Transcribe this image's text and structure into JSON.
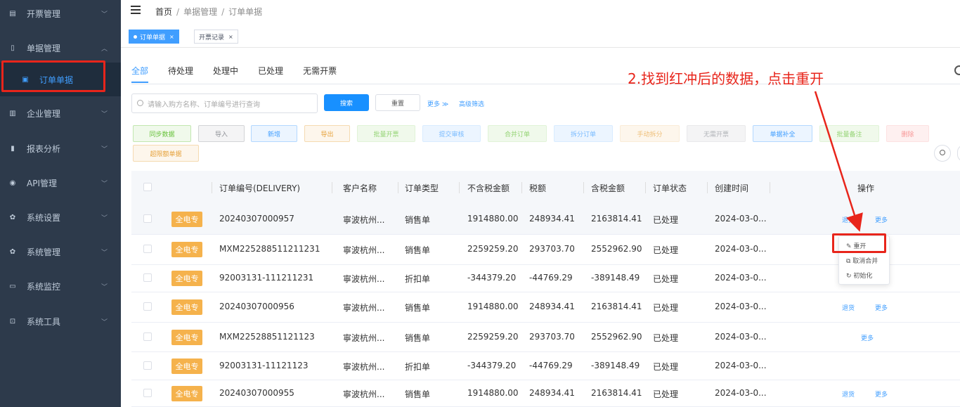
{
  "sidebar": {
    "items": [
      {
        "label": "开票管理",
        "icon": "invoice-icon"
      },
      {
        "label": "单据管理",
        "icon": "document-icon"
      },
      {
        "label": "订单单据",
        "icon": "order-icon"
      },
      {
        "label": "企业管理",
        "icon": "enterprise-icon"
      },
      {
        "label": "报表分析",
        "icon": "bar-chart-icon"
      },
      {
        "label": "API管理",
        "icon": "api-icon"
      },
      {
        "label": "系统设置",
        "icon": "gear-icon"
      },
      {
        "label": "系统管理",
        "icon": "gear-icon"
      },
      {
        "label": "系统监控",
        "icon": "monitor-icon"
      },
      {
        "label": "系统工具",
        "icon": "tool-icon"
      }
    ]
  },
  "breadcrumb": [
    "首页",
    "单据管理",
    "订单单据"
  ],
  "visited_tags": [
    {
      "label": "订单单据",
      "active": true
    },
    {
      "label": "开票记录",
      "active": false
    }
  ],
  "tabs": [
    "全部",
    "待处理",
    "处理中",
    "已处理",
    "无需开票"
  ],
  "annotation": "2.找到红冲后的数据，点击重开",
  "search": {
    "placeholder": "请输入购方名称、订单编号进行查询",
    "search_label": "搜索",
    "reset_label": "重置",
    "more_label": "更多 ≫",
    "advanced_label": "高级筛选"
  },
  "actions": [
    "同步数据",
    "导入",
    "新增",
    "导出",
    "批量开票",
    "提交审核",
    "合并订单",
    "拆分订单",
    "手动拆分",
    "无需开票",
    "单据补全",
    "批量备注",
    "删除",
    "超限额单据"
  ],
  "table": {
    "headers": [
      "订单编号(DELIVERY)",
      "客户名称",
      "订单类型",
      "不含税金额",
      "税额",
      "含税金额",
      "订单状态",
      "创建时间",
      "操作"
    ],
    "badge": "全电专",
    "rows": [
      {
        "no": "20240307000957",
        "customer": "寧波杭州...",
        "type": "销售单",
        "amount": "1914880.00",
        "tax": "248934.41",
        "total": "2163814.41",
        "status": "已处理",
        "time": "2024-03-0...",
        "ops": [
          "退货",
          "更多"
        ]
      },
      {
        "no": "MXM225288511211231",
        "customer": "寧波杭州...",
        "type": "销售单",
        "amount": "2259259.20",
        "tax": "293703.70",
        "total": "2552962.90",
        "status": "已处理",
        "time": "2024-03-0...",
        "ops": []
      },
      {
        "no": "92003131-111211231",
        "customer": "寧波杭州...",
        "type": "折扣单",
        "amount": "-344379.20",
        "tax": "-44769.29",
        "total": "-389148.49",
        "status": "已处理",
        "time": "2024-03-0...",
        "ops": []
      },
      {
        "no": "20240307000956",
        "customer": "寧波杭州...",
        "type": "销售单",
        "amount": "1914880.00",
        "tax": "248934.41",
        "total": "2163814.41",
        "status": "已处理",
        "time": "2024-03-0...",
        "ops": [
          "退货",
          "更多"
        ]
      },
      {
        "no": "MXM22528851121123",
        "customer": "寧波杭州...",
        "type": "销售单",
        "amount": "2259259.20",
        "tax": "293703.70",
        "total": "2552962.90",
        "status": "已处理",
        "time": "2024-03-0...",
        "ops": [
          "更多"
        ]
      },
      {
        "no": "92003131-11121123",
        "customer": "寧波杭州...",
        "type": "折扣单",
        "amount": "-344379.20",
        "tax": "-44769.29",
        "total": "-389148.49",
        "status": "已处理",
        "time": "2024-03-0...",
        "ops": []
      },
      {
        "no": "20240307000955",
        "customer": "寧波杭州...",
        "type": "销售单",
        "amount": "1914880.00",
        "tax": "248934.41",
        "total": "2163814.41",
        "status": "已处理",
        "time": "2024-03-0...",
        "ops": [
          "退货",
          "更多"
        ]
      }
    ]
  },
  "dropdown": [
    "重开",
    "取消合并",
    "初始化"
  ],
  "colors": {
    "sidebar_bg": "#2d3a4b",
    "primary": "#409eff",
    "highlight_red": "#e8251b",
    "badge": "#f5b24c"
  }
}
